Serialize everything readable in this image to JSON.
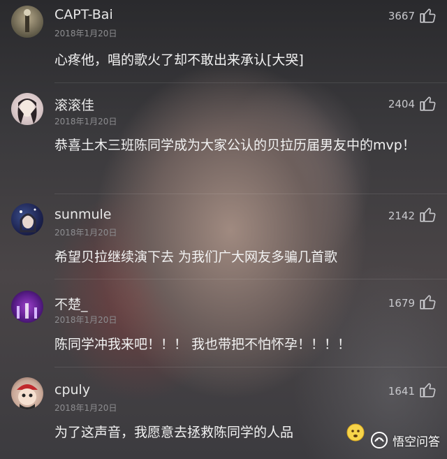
{
  "comments": [
    {
      "username": "CAPT-Bai",
      "date": "2018年1月20日",
      "likes": "3667",
      "text": "心疼他，唱的歌火了却不敢出来承认[大哭]"
    },
    {
      "username": "滚滚佳",
      "date": "2018年1月20日",
      "likes": "2404",
      "text": "恭喜土木三班陈同学成为大家公认的贝拉历届男友中的mvp！"
    },
    {
      "username": "sunmule",
      "date": "2018年1月20日",
      "likes": "2142",
      "text": "希望贝拉继续演下去 为我们广大网友多骗几首歌"
    },
    {
      "username": "不楚_",
      "date": "2018年1月20日",
      "likes": "1679",
      "text": "陈同学冲我来吧！！！ 我也带把不怕怀孕！！！！"
    },
    {
      "username": "cpuly",
      "date": "2018年1月20日",
      "likes": "1641",
      "text": "为了这声音，我愿意去拯救陈同学的人品"
    }
  ],
  "icons": {
    "like": "thumbs-up-icon",
    "emoji": "smiley-emoji-icon"
  },
  "watermark": {
    "text": "悟空问答"
  }
}
